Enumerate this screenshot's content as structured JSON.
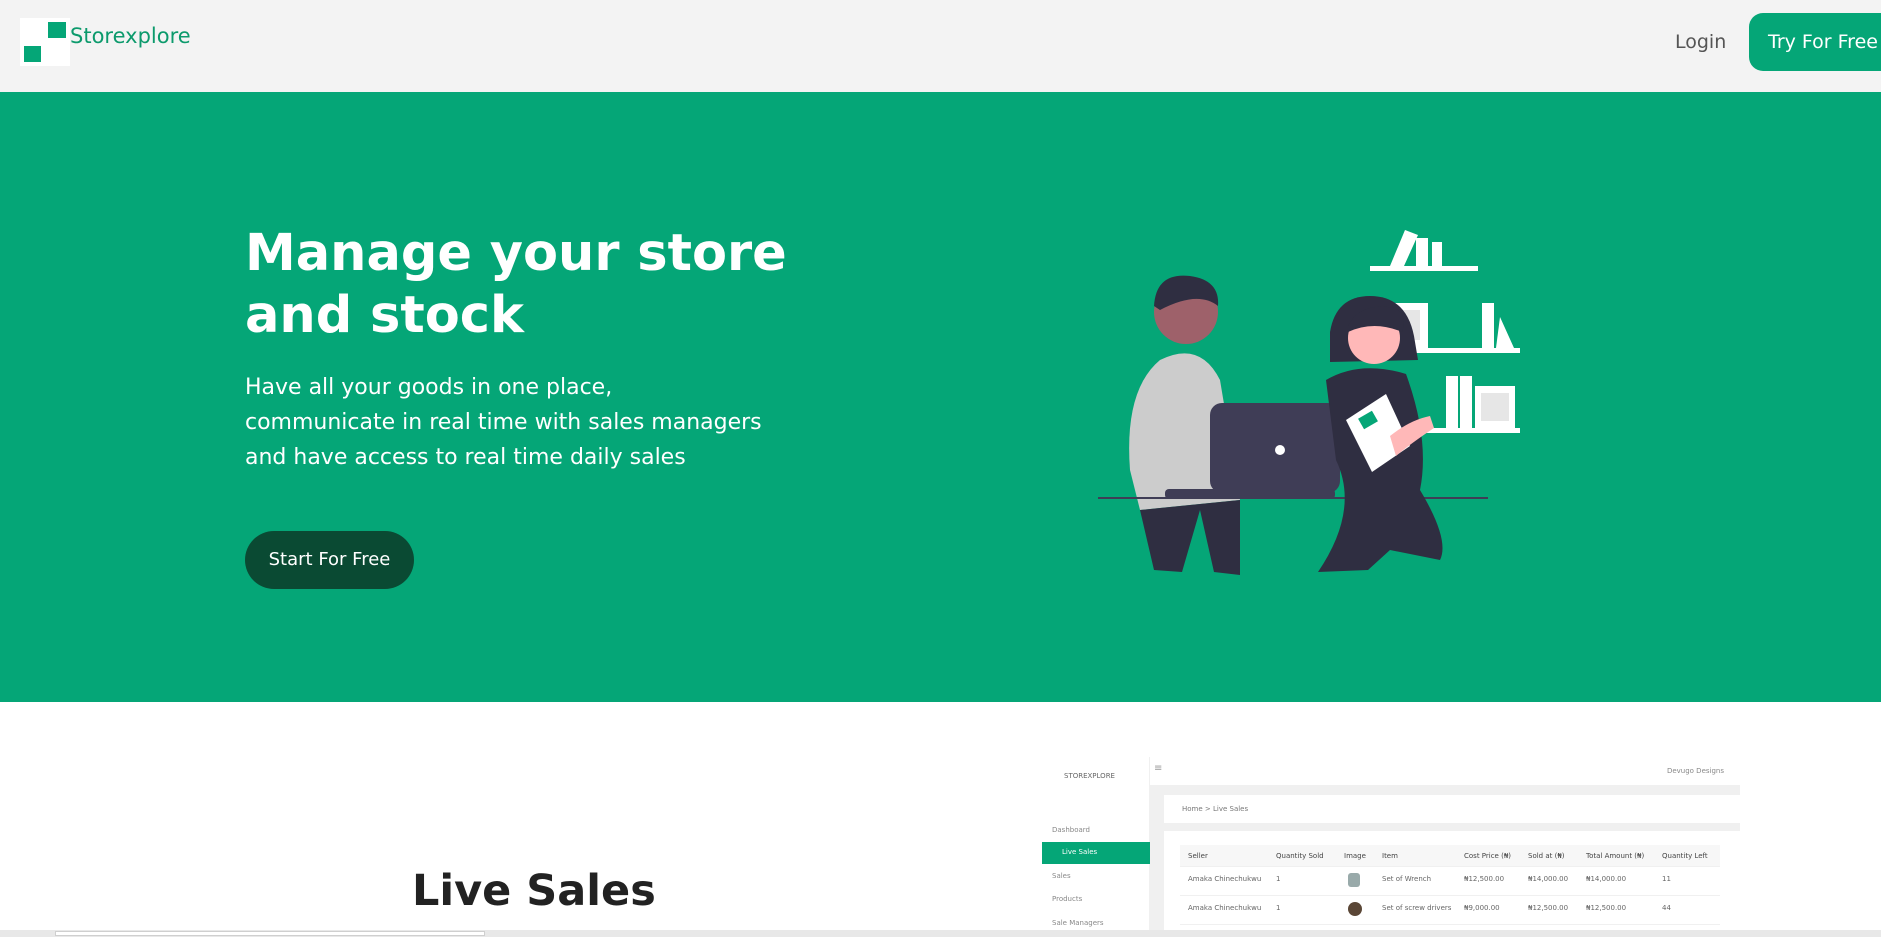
{
  "nav": {
    "brand": "Storexplore",
    "login": "Login",
    "try_button": "Try For Free",
    "logo_icon": "storexplore-logo-icon",
    "accent": "#05a677"
  },
  "hero": {
    "title": "Manage your store and stock",
    "subtitle": "Have all your goods in one place, communicate in real time with sales managers and have access to real time daily sales",
    "cta": "Start For Free",
    "illustration_icon": "team-laptop-illustration",
    "background": "#05a677",
    "cta_background": "#0a4a33"
  },
  "live_sales": {
    "title": "Live Sales",
    "preview": {
      "logo": "STOREXPLORE",
      "account": "Devugo Designs",
      "breadcrumb": "Home > Live Sales",
      "sidebar": [
        "Dashboard",
        "Live Sales",
        "Sales",
        "Products",
        "Sale Managers"
      ],
      "active_item": "Live Sales",
      "columns": [
        "Seller",
        "Quantity Sold",
        "Image",
        "Item",
        "Cost Price (₦)",
        "Sold at (₦)",
        "Total Amount (₦)",
        "Quantity Left"
      ],
      "rows": [
        [
          "Amaka Chinechukwu",
          "1",
          "",
          "Set of Wrench",
          "₦12,500.00",
          "₦14,000.00",
          "₦14,000.00",
          "11"
        ],
        [
          "Amaka Chinechukwu",
          "1",
          "",
          "Set of screw drivers",
          "₦9,000.00",
          "₦12,500.00",
          "₦12,500.00",
          "44"
        ]
      ]
    }
  }
}
